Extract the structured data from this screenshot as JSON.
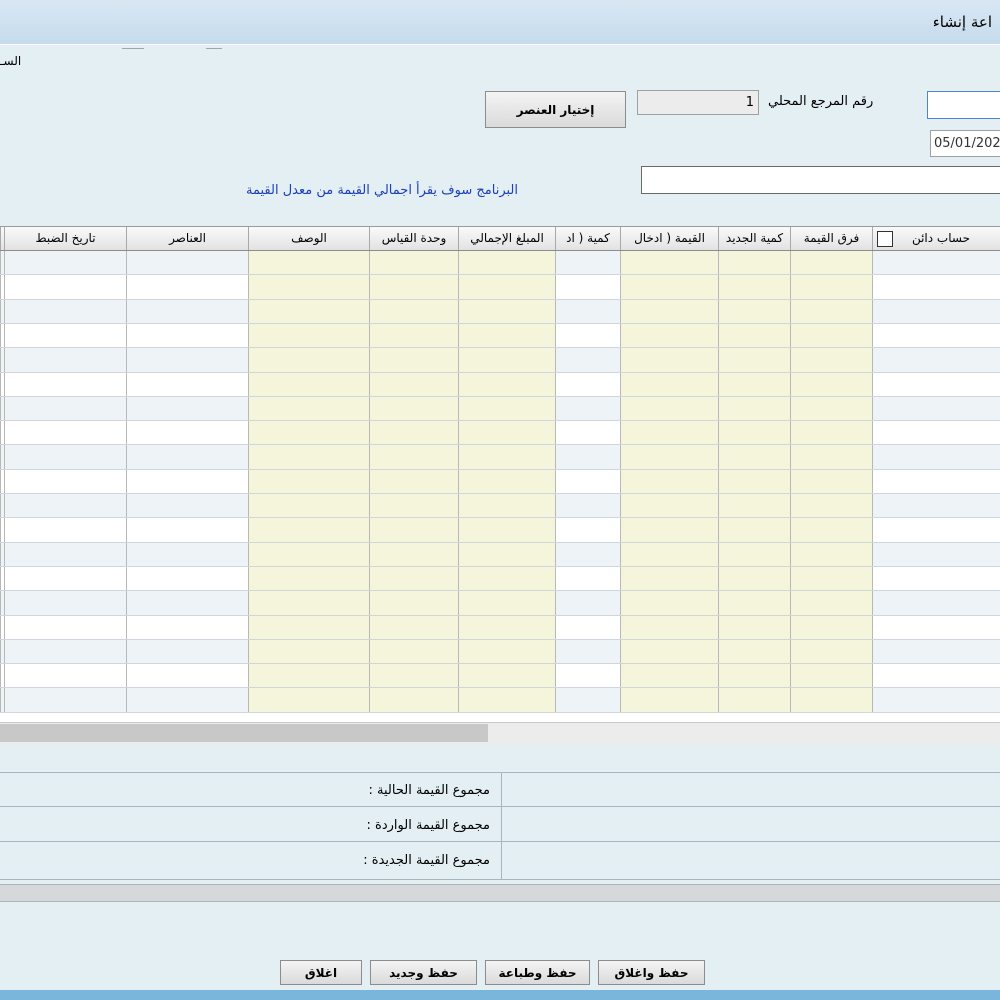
{
  "window": {
    "title": "اعة إنشاء"
  },
  "tab_hint": "السـ",
  "header": {
    "local_ref_label": "رقم المرجع المحلي",
    "local_ref_value": "1",
    "choose_item_label": "إختيار العنصر",
    "date_value": "05/01/202",
    "note": "البرنامج سوف يقرأ اجمالي القيمة من معدل القيمة"
  },
  "grid": {
    "columns": [
      "حساب دائن",
      "فرق القيمة",
      "كمية الجديد",
      "القيمة ( ادخال",
      "كمية ( اد",
      "المبلغ الإجمالي",
      "وحدة القياس",
      "الوصف",
      "العناصر",
      "تاريخ الضبط"
    ],
    "row_count": 19,
    "colors": {
      "editable": "#ffffff",
      "alt": "#eef3f8",
      "readonly": "#f5f5dc",
      "grid_line": "#cfd6de"
    }
  },
  "totals": {
    "current_label": "مجموع القيمة الحالية :",
    "incoming_label": "مجموع القيمة الواردة :",
    "new_label": "مجموع القيمة الجديدة :"
  },
  "buttons": {
    "save_close": "حفظ واغلاق",
    "save_print": "حفظ وطباعة",
    "save_new": "حفظ وجديد",
    "close": "اغلاق"
  }
}
